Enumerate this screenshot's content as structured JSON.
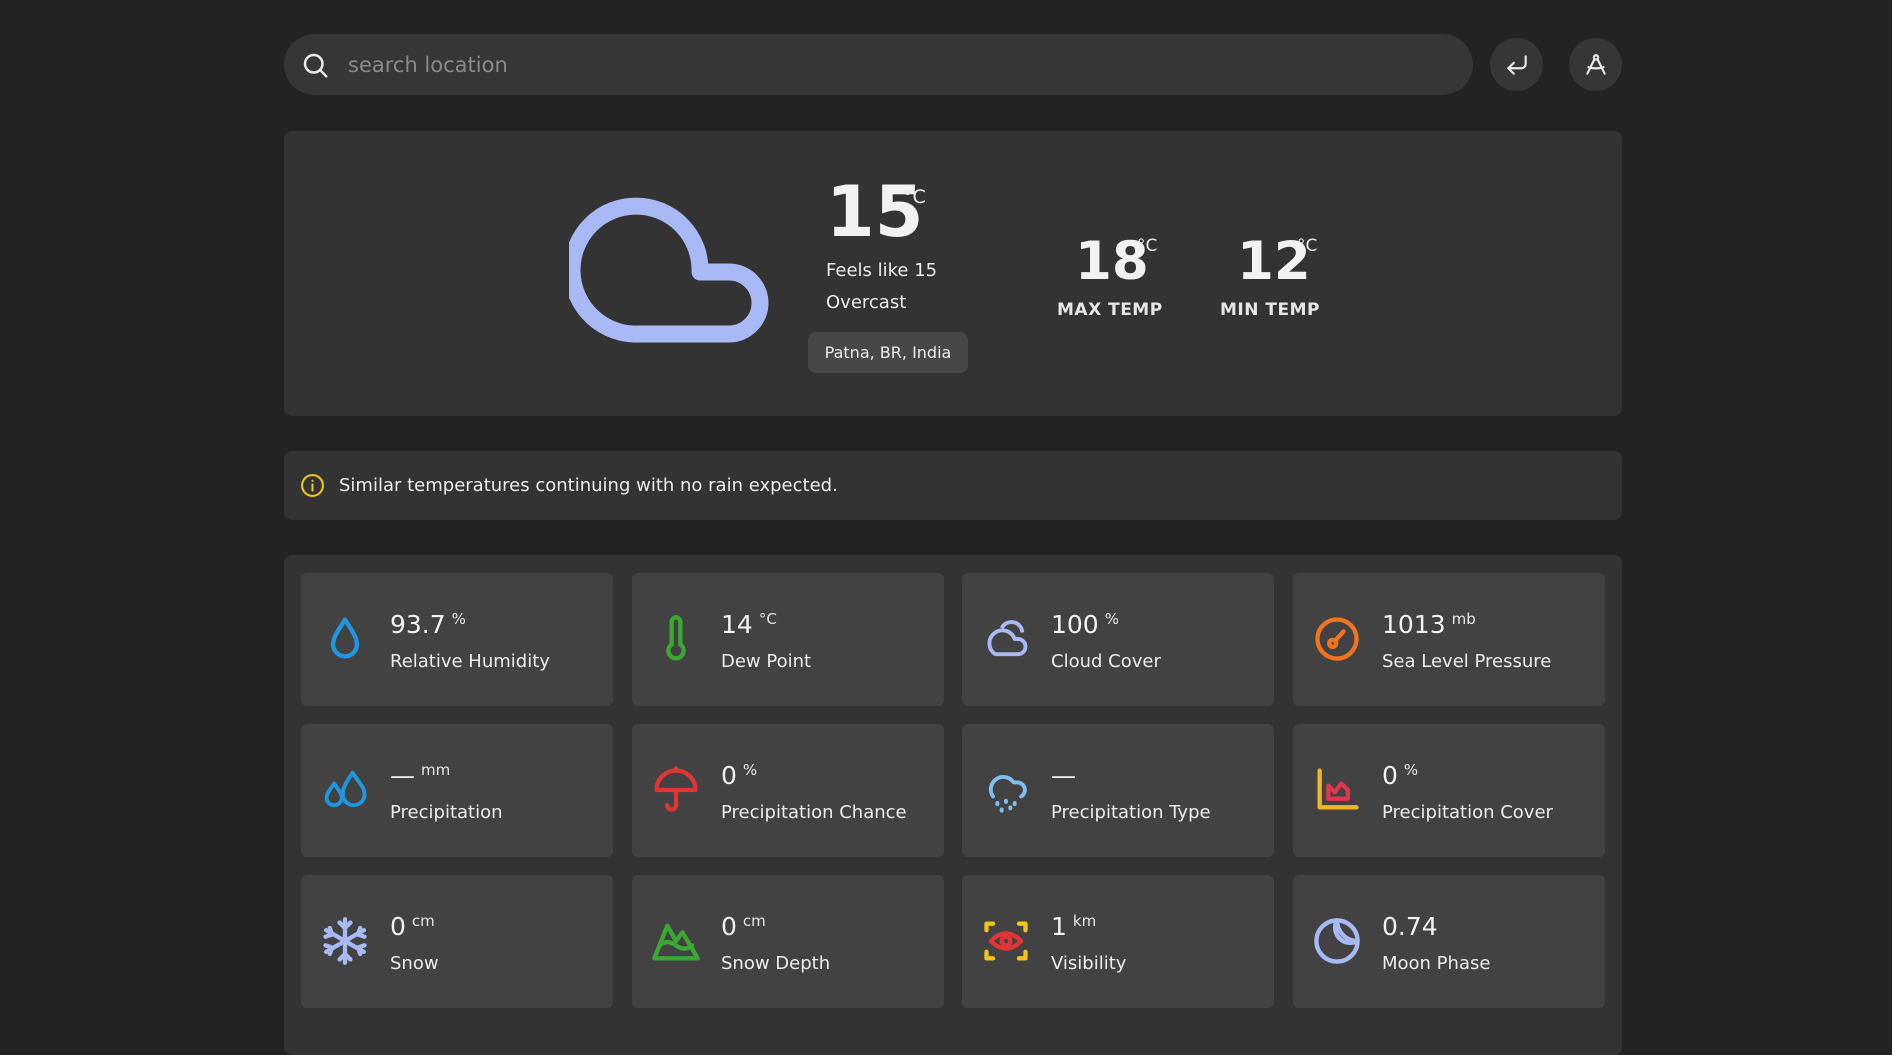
{
  "search": {
    "placeholder": "search location"
  },
  "current": {
    "temp": "15",
    "unit": "°C",
    "feels_like": "Feels like 15",
    "condition": "Overcast",
    "location": "Patna, BR, India"
  },
  "max": {
    "value": "18",
    "unit": "°C",
    "label": "MAX TEMP"
  },
  "min": {
    "value": "12",
    "unit": "°C",
    "label": "MIN TEMP"
  },
  "alert": {
    "text": "Similar temperatures continuing with no rain expected."
  },
  "cards": [
    {
      "value": "93.7",
      "unit": "%",
      "label": "Relative Humidity",
      "icon": "droplet-icon",
      "color": "#1e96e0"
    },
    {
      "value": "14",
      "unit": "°C",
      "label": "Dew Point",
      "icon": "thermometer-icon",
      "color": "#3aa832"
    },
    {
      "value": "100",
      "unit": "%",
      "label": "Cloud Cover",
      "icon": "cloud-icon",
      "color": "#a9b9f5"
    },
    {
      "value": "1013",
      "unit": "mb",
      "label": "Sea Level Pressure",
      "icon": "gauge-icon",
      "color": "#f07420"
    },
    {
      "value": "—",
      "unit": "mm",
      "label": "Precipitation",
      "icon": "droplets-icon",
      "color": "#1e96e0"
    },
    {
      "value": "0",
      "unit": "%",
      "label": "Precipitation Chance",
      "icon": "umbrella-icon",
      "color": "#e03535"
    },
    {
      "value": "—",
      "unit": "",
      "label": "Precipitation Type",
      "icon": "cloud-drizzle-icon",
      "color": "#7fbff0"
    },
    {
      "value": "0",
      "unit": "%",
      "label": "Precipitation Cover",
      "icon": "area-chart-icon",
      "color": "#f0b429"
    },
    {
      "value": "0",
      "unit": "cm",
      "label": "Snow",
      "icon": "snowflake-icon",
      "color": "#a9b9f5"
    },
    {
      "value": "0",
      "unit": "cm",
      "label": "Snow Depth",
      "icon": "mountain-snow-icon",
      "color": "#3aa832"
    },
    {
      "value": "1",
      "unit": "km",
      "label": "Visibility",
      "icon": "scan-eye-icon",
      "color": "#f0c419"
    },
    {
      "value": "0.74",
      "unit": "",
      "label": "Moon Phase",
      "icon": "moon-icon",
      "color": "#a9b9f5"
    }
  ],
  "colors": {
    "background": "#232323",
    "panel": "#333333",
    "card": "#424242",
    "hero_cloud": "#a9b9f5",
    "alert_icon": "#f0c419"
  }
}
